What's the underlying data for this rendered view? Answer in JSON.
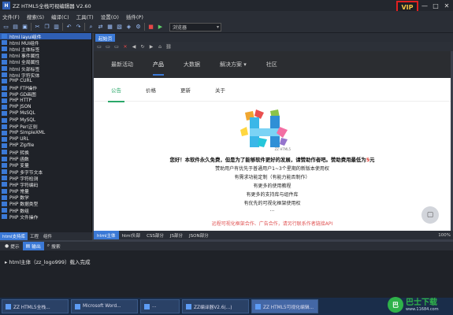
{
  "window": {
    "title": "ZZ HTML5全栈可视编辑器 V2.60",
    "vip_label": "VIP",
    "controls": [
      "—",
      "□",
      "✕"
    ]
  },
  "menu": [
    "文件(F)",
    "搜索(S)",
    "编译(C)",
    "工具(T)",
    "设置(O)",
    "插件(P)"
  ],
  "toolbar": {
    "browser_select": "浏览器"
  },
  "tree": [
    "html layui组件",
    "html MUI组件",
    "html 主体标签",
    "html 事件属性",
    "html 全局属性",
    "html 头部标签",
    "html 字符实体",
    "PHP CURL",
    "PHP FTP操作",
    "PHP GD画图",
    "PHP HTTP",
    "PHP JSON",
    "PHP MsSQL",
    "PHP MySQL",
    "PHP Perl正则",
    "PHP SimpleXML",
    "PHP URL",
    "PHP Zipfile",
    "PHP 转换",
    "PHP 函数",
    "PHP 变量",
    "PHP 多字节文本",
    "PHP 字符检测",
    "PHP 字符编码",
    "PHP 常量",
    "PHP 数学",
    "PHP 数据类型",
    "PHP 数组",
    "PHP 文件操作"
  ],
  "left_tabs": [
    "html支持库",
    "工程",
    "组件"
  ],
  "doc_tab": "起始页",
  "site": {
    "nav": [
      "最新活动",
      "产品",
      "大数据",
      "解决方案 ▾",
      "社区"
    ],
    "sub": [
      "公告",
      "价格",
      "更新",
      "关于"
    ],
    "logo_caption": "ZZ HTML5",
    "notice_line1_a": "您好！本软件永久免费，但是为了能够软件更好的发展，请赞助作者吧。赞助费用最低为",
    "notice_line1_hl": "5",
    "notice_line1_b": "元",
    "lines": [
      "赞助用户有优先于普通用户1~3个星期的新版本使用权",
      "有需求功能定制（有能力能否制作）",
      "有更多的使用教程",
      "有更多的支持库与组件库",
      "有优先的可视化框架使用权",
      "..."
    ],
    "footer_red": "远程可视化框架合作、广告合作，请另行联系作者链接API"
  },
  "bottom_tabs": [
    "html主体",
    "html头部",
    "CSS部分",
    "JS部分",
    "JSON部分"
  ],
  "zoom": "100%",
  "output_tabs": [
    "提示",
    "输出",
    "搜索"
  ],
  "output_text": "html主体（zz_logo999）载入完成",
  "taskbar": [
    "ZZ HTML5全栈...",
    "Microsoft Word...",
    "...",
    "ZZ编译器V2.6(...)",
    "ZZ HTML5可视化编辑..."
  ],
  "watermark": {
    "title": "巴士下载",
    "url": "www.11684.com"
  }
}
